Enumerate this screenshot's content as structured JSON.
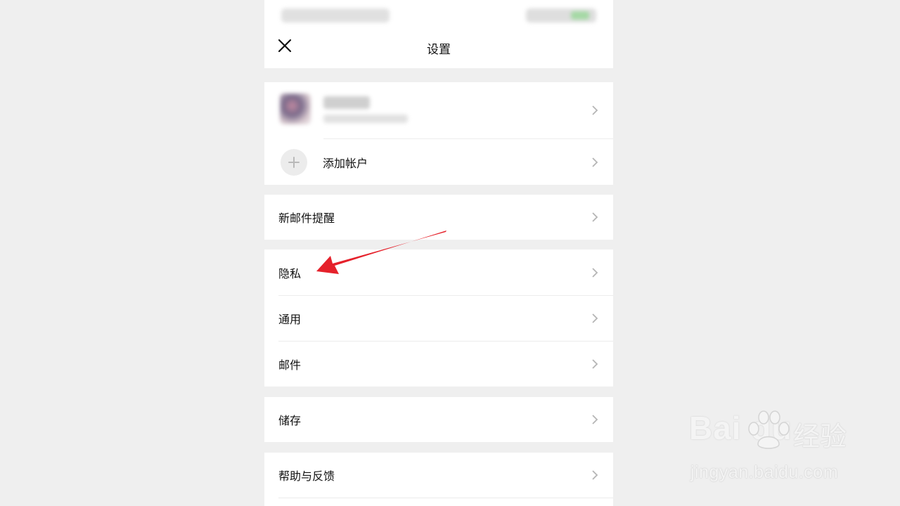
{
  "nav": {
    "title": "设置"
  },
  "accounts": {
    "add_account_label": "添加帐户"
  },
  "menu": {
    "new_mail_alert": "新邮件提醒",
    "privacy": "隐私",
    "general": "通用",
    "mail": "邮件",
    "storage": "储存",
    "help_feedback": "帮助与反馈"
  },
  "annotation": {
    "arrow_color": "#e5212b"
  },
  "watermark": {
    "brand": "Bai du",
    "cn": "经验",
    "url": "jingyan.baidu.com"
  }
}
